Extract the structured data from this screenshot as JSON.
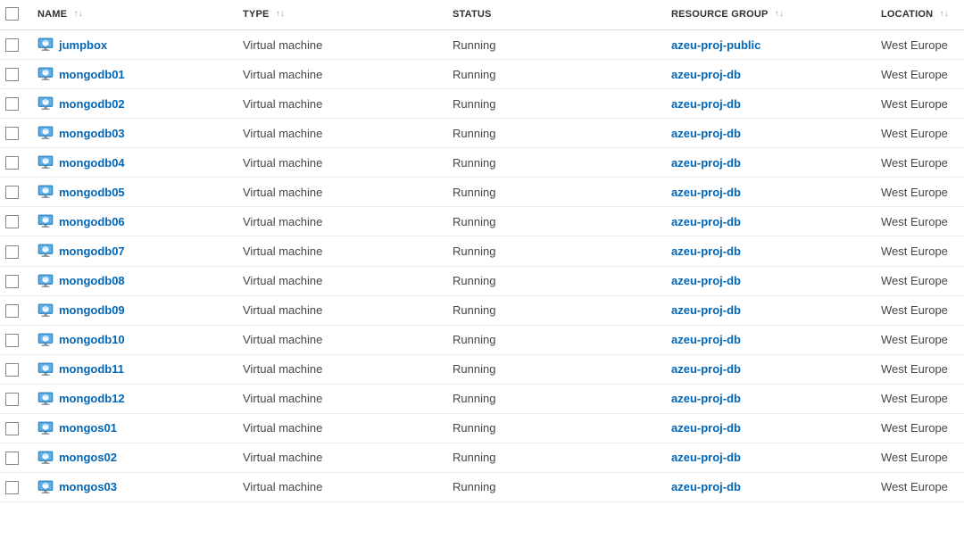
{
  "columns": {
    "name": "NAME",
    "type": "TYPE",
    "status": "STATUS",
    "resource_group": "RESOURCE GROUP",
    "location": "LOCATION"
  },
  "sort_glyph": "↑↓",
  "rows": [
    {
      "name": "jumpbox",
      "type": "Virtual machine",
      "status": "Running",
      "resource_group": "azeu-proj-public",
      "location": "West Europe"
    },
    {
      "name": "mongodb01",
      "type": "Virtual machine",
      "status": "Running",
      "resource_group": "azeu-proj-db",
      "location": "West Europe"
    },
    {
      "name": "mongodb02",
      "type": "Virtual machine",
      "status": "Running",
      "resource_group": "azeu-proj-db",
      "location": "West Europe"
    },
    {
      "name": "mongodb03",
      "type": "Virtual machine",
      "status": "Running",
      "resource_group": "azeu-proj-db",
      "location": "West Europe"
    },
    {
      "name": "mongodb04",
      "type": "Virtual machine",
      "status": "Running",
      "resource_group": "azeu-proj-db",
      "location": "West Europe"
    },
    {
      "name": "mongodb05",
      "type": "Virtual machine",
      "status": "Running",
      "resource_group": "azeu-proj-db",
      "location": "West Europe"
    },
    {
      "name": "mongodb06",
      "type": "Virtual machine",
      "status": "Running",
      "resource_group": "azeu-proj-db",
      "location": "West Europe"
    },
    {
      "name": "mongodb07",
      "type": "Virtual machine",
      "status": "Running",
      "resource_group": "azeu-proj-db",
      "location": "West Europe"
    },
    {
      "name": "mongodb08",
      "type": "Virtual machine",
      "status": "Running",
      "resource_group": "azeu-proj-db",
      "location": "West Europe"
    },
    {
      "name": "mongodb09",
      "type": "Virtual machine",
      "status": "Running",
      "resource_group": "azeu-proj-db",
      "location": "West Europe"
    },
    {
      "name": "mongodb10",
      "type": "Virtual machine",
      "status": "Running",
      "resource_group": "azeu-proj-db",
      "location": "West Europe"
    },
    {
      "name": "mongodb11",
      "type": "Virtual machine",
      "status": "Running",
      "resource_group": "azeu-proj-db",
      "location": "West Europe"
    },
    {
      "name": "mongodb12",
      "type": "Virtual machine",
      "status": "Running",
      "resource_group": "azeu-proj-db",
      "location": "West Europe"
    },
    {
      "name": "mongos01",
      "type": "Virtual machine",
      "status": "Running",
      "resource_group": "azeu-proj-db",
      "location": "West Europe"
    },
    {
      "name": "mongos02",
      "type": "Virtual machine",
      "status": "Running",
      "resource_group": "azeu-proj-db",
      "location": "West Europe"
    },
    {
      "name": "mongos03",
      "type": "Virtual machine",
      "status": "Running",
      "resource_group": "azeu-proj-db",
      "location": "West Europe"
    }
  ]
}
